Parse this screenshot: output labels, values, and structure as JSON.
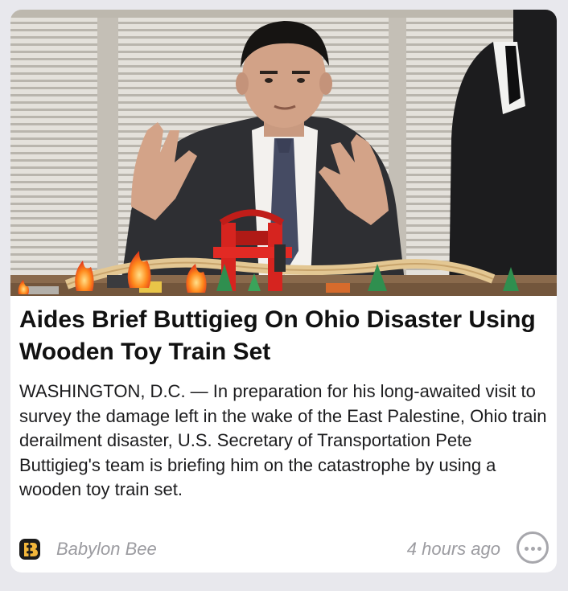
{
  "article": {
    "headline": "Aides Brief Buttigieg On Ohio Disaster Using Wooden Toy Train Set",
    "summary": "WASHINGTON, D.C. — In preparation for his long-awaited visit to survey the damage left in the wake of the East Palestine, Ohio train derailment disaster, U.S. Secretary of Transportation Pete Buttigieg's team is briefing him on the catastrophe by using a wooden toy train set.",
    "image_icon": "photo-man-with-toy-train-set"
  },
  "footer": {
    "source_name": "Babylon Bee",
    "source_icon": "babylon-bee-logo",
    "timestamp": "4 hours ago",
    "more_icon": "ellipsis-circle-icon"
  },
  "colors": {
    "card_background": "#ffffff",
    "page_background": "#e8e8ed",
    "headline_text": "#111111",
    "meta_text": "#9b9ba0"
  }
}
